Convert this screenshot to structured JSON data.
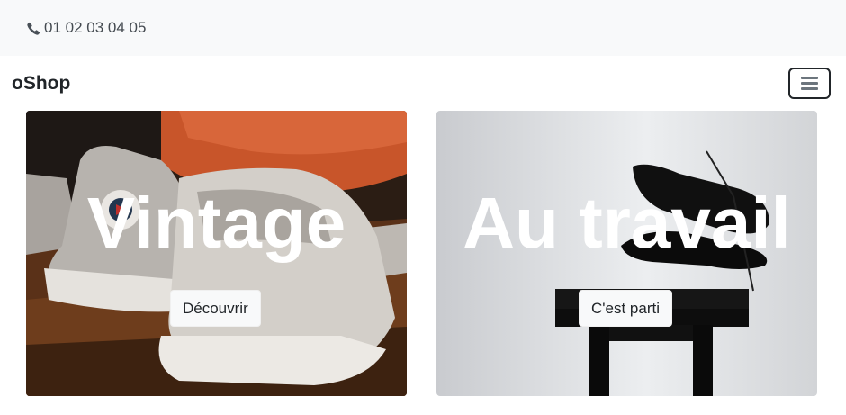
{
  "topbar": {
    "phone_icon": "phone-icon",
    "phone": "01 02 03 04 05"
  },
  "navbar": {
    "brand": "oShop",
    "toggler_icon": "hamburger-menu-icon"
  },
  "cards": [
    {
      "title": "Vintage",
      "button": "Découvrir",
      "image": "worn-canvas-sneakers-photo"
    },
    {
      "title": "Au travail",
      "button": "C'est parti",
      "image": "dress-shoes-on-stool-photo"
    }
  ]
}
